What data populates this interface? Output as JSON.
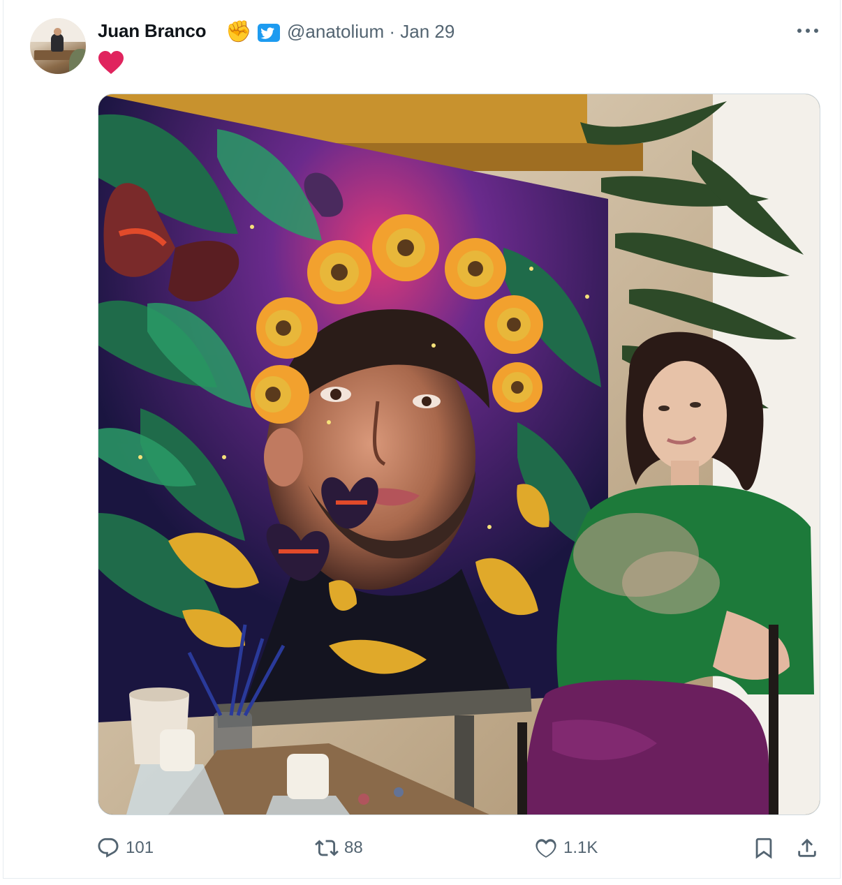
{
  "tweet": {
    "author_name": "Juan Branco",
    "author_emoji": "✊",
    "handle_date": "@anatolium · Jan 29",
    "text_emoji": "heart-emoji",
    "more_icon": "more-icon"
  },
  "actions": {
    "replies": "101",
    "retweets": "88",
    "likes": "1.1K",
    "bookmark_icon": "bookmark-icon",
    "share_icon": "share-icon"
  },
  "colors": {
    "text": "#0f1419",
    "muted": "#536471",
    "verified_blue": "#1d9bf0",
    "heart_red": "#e0245e",
    "sweater_green": "#1d7a3a",
    "pants_purple": "#6b1f5e"
  }
}
